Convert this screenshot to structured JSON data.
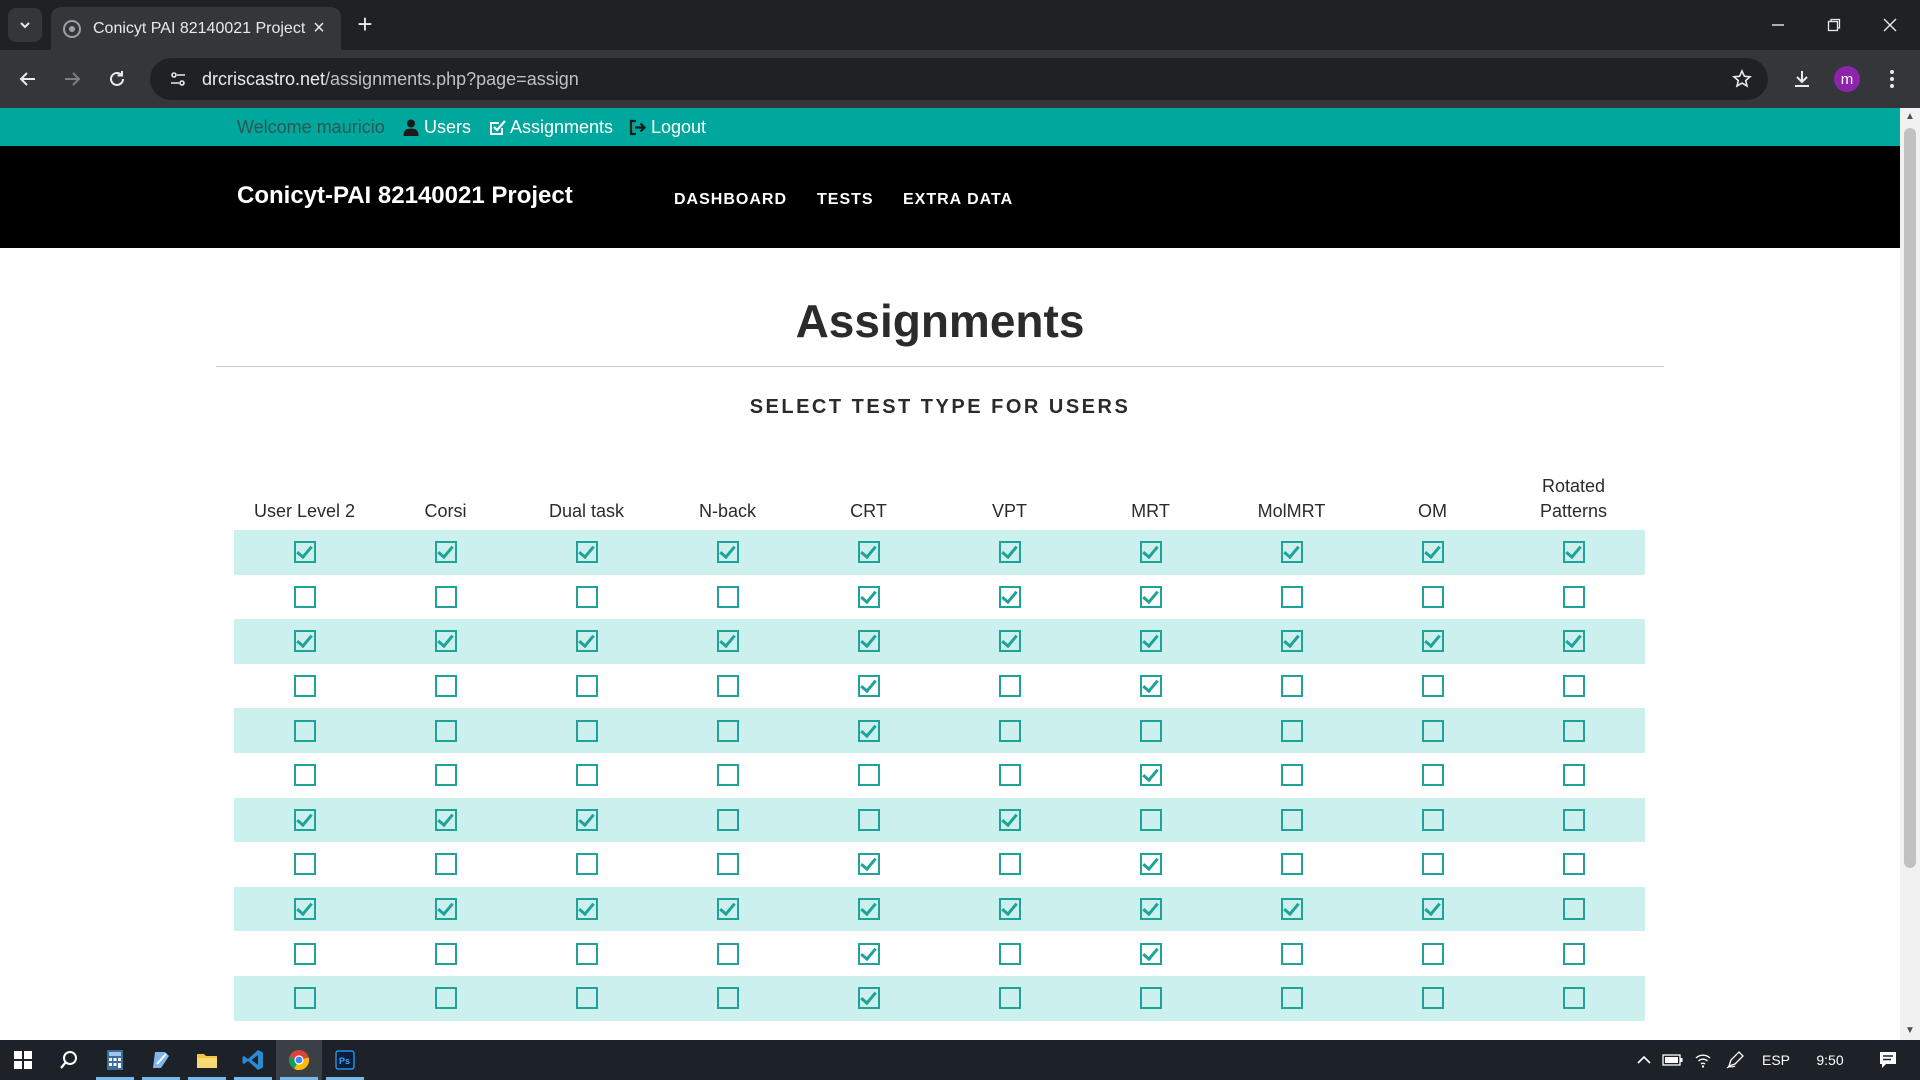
{
  "browser": {
    "tab_title": "Conicyt PAI 82140021 Project",
    "url_host": "drcriscastro.net",
    "url_path": "/assignments.php?page=assign",
    "profile_initial": "m"
  },
  "userbar": {
    "welcome": "Welcome mauricio",
    "users": "Users",
    "assignments": "Assignments",
    "logout": "Logout"
  },
  "navbar": {
    "brand": "Conicyt-PAI 82140021 Project",
    "links": [
      "DASHBOARD",
      "TESTS",
      "EXTRA DATA"
    ]
  },
  "page": {
    "title": "Assignments",
    "subtitle": "SELECT TEST TYPE FOR USERS"
  },
  "table": {
    "columns": [
      "User Level 2",
      "Corsi",
      "Dual task",
      "N-back",
      "CRT",
      "VPT",
      "MRT",
      "MolMRT",
      "OM",
      "Rotated Patterns"
    ],
    "rows": [
      [
        1,
        1,
        1,
        1,
        1,
        1,
        1,
        1,
        1,
        1
      ],
      [
        0,
        0,
        0,
        0,
        1,
        1,
        1,
        0,
        0,
        0
      ],
      [
        1,
        1,
        1,
        1,
        1,
        1,
        1,
        1,
        1,
        1
      ],
      [
        0,
        0,
        0,
        0,
        1,
        0,
        1,
        0,
        0,
        0
      ],
      [
        0,
        0,
        0,
        0,
        1,
        0,
        0,
        0,
        0,
        0
      ],
      [
        0,
        0,
        0,
        0,
        0,
        0,
        1,
        0,
        0,
        0
      ],
      [
        1,
        1,
        1,
        0,
        0,
        1,
        0,
        0,
        0,
        0
      ],
      [
        0,
        0,
        0,
        0,
        1,
        0,
        1,
        0,
        0,
        0
      ],
      [
        1,
        1,
        1,
        1,
        1,
        1,
        1,
        1,
        1,
        0
      ],
      [
        0,
        0,
        0,
        0,
        1,
        0,
        1,
        0,
        0,
        0
      ],
      [
        0,
        0,
        0,
        0,
        1,
        0,
        0,
        0,
        0,
        0
      ]
    ]
  },
  "colors": {
    "teal": "#00a79d",
    "row_stripe": "#ccf0ed",
    "checkbox": "#1fa398"
  },
  "taskbar": {
    "language": "ESP",
    "time": "9:50"
  }
}
